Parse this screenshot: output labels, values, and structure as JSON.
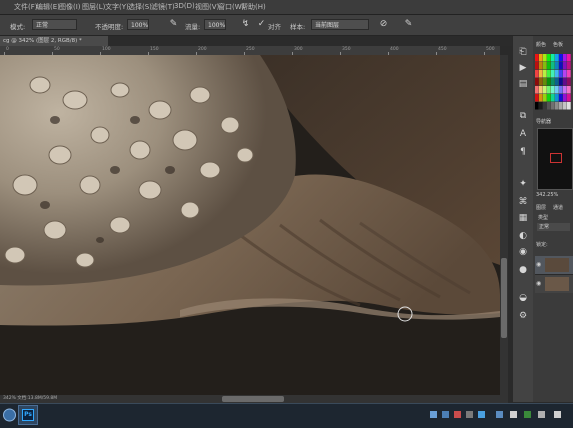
{
  "menu": {
    "items": [
      "文件(F)",
      "编辑(E)",
      "图像(I)",
      "图层(L)",
      "文字(Y)",
      "选择(S)",
      "滤镜(T)",
      "3D(D)",
      "视图(V)",
      "窗口(W)",
      "帮助(H)"
    ]
  },
  "options": {
    "mode_label": "模式:",
    "mode_value": "正常",
    "opacity_label": "不透明度:",
    "opacity_value": "100%",
    "flow_label": "流量:",
    "flow_value": "100%",
    "align_label": "对齐",
    "sample_label": "样本:",
    "sample_value": "当前图层"
  },
  "document": {
    "tab_label": "cg @ 342% (图层 2, RGB/8) *",
    "status_text": "342% 文档:13.8M/59.8M"
  },
  "ruler": {
    "ticks": [
      "0",
      "50",
      "100",
      "150",
      "200",
      "250",
      "300",
      "350",
      "400",
      "450",
      "500"
    ]
  },
  "panels": {
    "color_tab": "颜色",
    "swatch_tab": "色板",
    "nav_tab": "导航器",
    "zoom_text": "342.25%",
    "layers_tab": "图层",
    "channels_tab": "通道",
    "kind_label": "类型",
    "blend_value": "正常",
    "lock_label": "锁定:"
  },
  "colors": {
    "chrome_dark": "#2a2a2a",
    "panel": "#3b3b3b",
    "taskbar": "#1d2630",
    "ps_blue": "#31a8ff",
    "canvas_bg": "#231f1b",
    "clay_light": "#b5a895",
    "clay_dark": "#5a4838"
  },
  "taskbar": {
    "ps_icon_label": "Ps"
  }
}
